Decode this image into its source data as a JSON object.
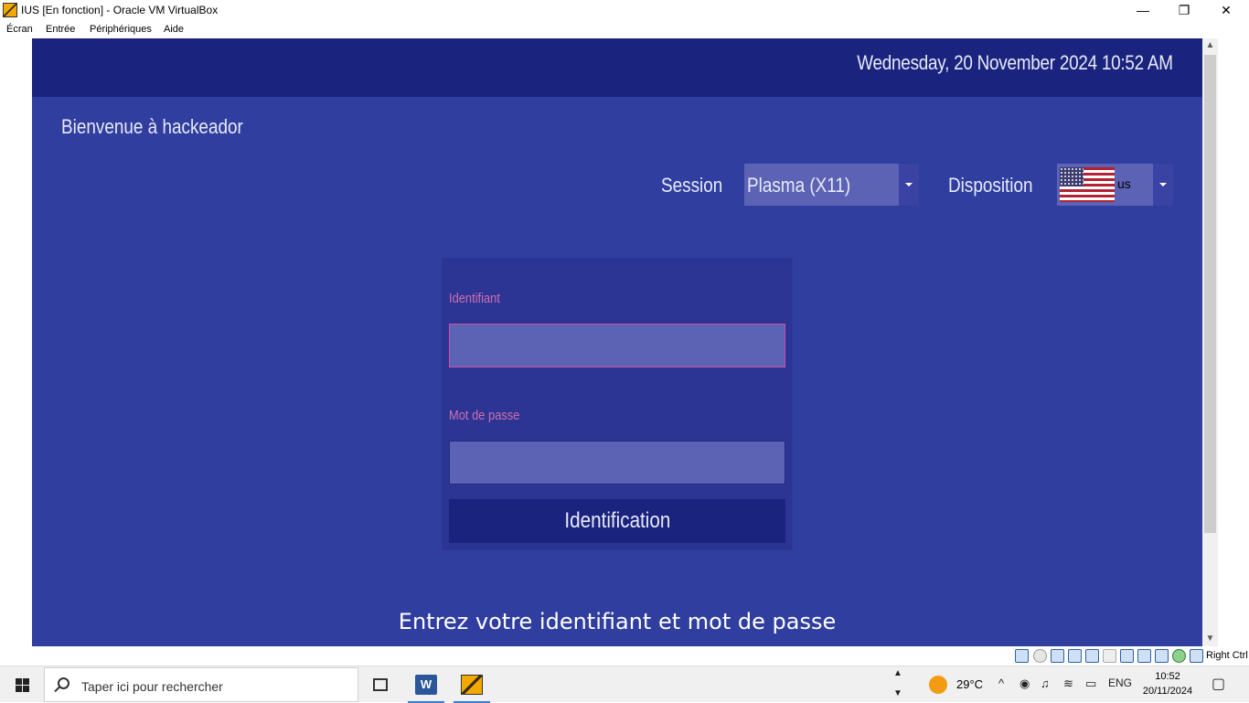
{
  "window": {
    "title": "IUS [En fonction] - Oracle VM VirtualBox",
    "controls": {
      "minimize": "—",
      "restore": "❐",
      "close": "✕"
    }
  },
  "menubar": {
    "items": [
      "Écran",
      "Entrée",
      "Périphériques",
      "Aide"
    ]
  },
  "greeter": {
    "datetime": "Wednesday, 20 November 2024  10:52 AM",
    "welcome": "Bienvenue à hackeador",
    "session_label": "Session",
    "session_value": "Plasma (X11)",
    "layout_label": "Disposition",
    "layout_value": "us",
    "username_label": "Identifiant",
    "username_value": "",
    "password_label": "Mot de passe",
    "password_value": "",
    "login_button": "Identification",
    "message": "Entrez votre identifiant et mot de passe",
    "colors": {
      "background": "#303e9f",
      "topbar": "#1a237e",
      "field": "#5c63b4",
      "accent": "#d06fb0"
    }
  },
  "statusbar": {
    "host_key": "Right Ctrl"
  },
  "taskbar": {
    "search_placeholder": "Taper ici pour rechercher",
    "weather_temp": "29°C",
    "language": "ENG",
    "time": "10:52",
    "date": "20/11/2024",
    "apps": [
      "task-view-icon",
      "word-icon",
      "virtualbox-icon"
    ]
  }
}
